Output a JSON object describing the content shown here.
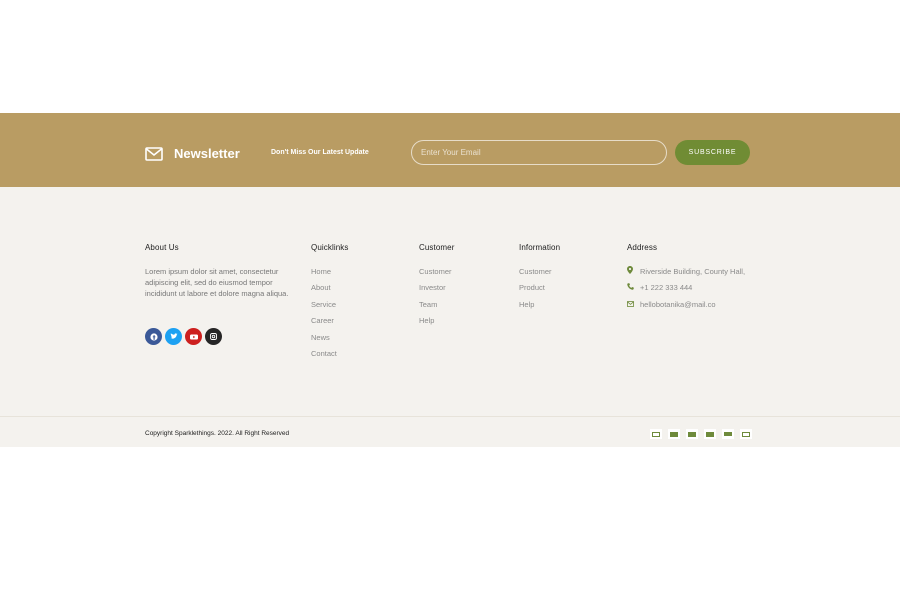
{
  "newsletter": {
    "title": "Newsletter",
    "tagline": "Don't Miss Our Latest Update",
    "email_placeholder": "Enter Your Email",
    "subscribe_label": "SUBSCRIBE",
    "icon": "mail-icon"
  },
  "about": {
    "heading": "About Us",
    "text": "Lorem ipsum dolor sit amet, consectetur adipiscing elit, sed do eiusmod tempor incididunt ut labore et dolore magna aliqua.",
    "social": [
      "facebook-icon",
      "twitter-icon",
      "youtube-icon",
      "instagram-icon"
    ]
  },
  "quicklinks": {
    "heading": "Quicklinks",
    "items": [
      "Home",
      "About",
      "Service",
      "Career",
      "News",
      "Contact"
    ]
  },
  "customer": {
    "heading": "Customer",
    "items": [
      "Customer",
      "Investor",
      "Team",
      "Help"
    ]
  },
  "information": {
    "heading": "Information",
    "items": [
      "Customer",
      "Product",
      "Help"
    ]
  },
  "address": {
    "heading": "Address",
    "location": "Riverside Building, County Hall,",
    "phone": "+1 222 333 444",
    "email": "hellobotanika@mail.co"
  },
  "bottom": {
    "copyright": "Copyright Sparklethings. 2022. All Right Reserved",
    "payments": [
      "card-icon",
      "card-icon",
      "card-icon",
      "card-icon",
      "card-icon",
      "card-icon"
    ]
  },
  "colors": {
    "band": "#b99c63",
    "accent": "#708c34",
    "footer_bg": "#f4f2ee"
  }
}
